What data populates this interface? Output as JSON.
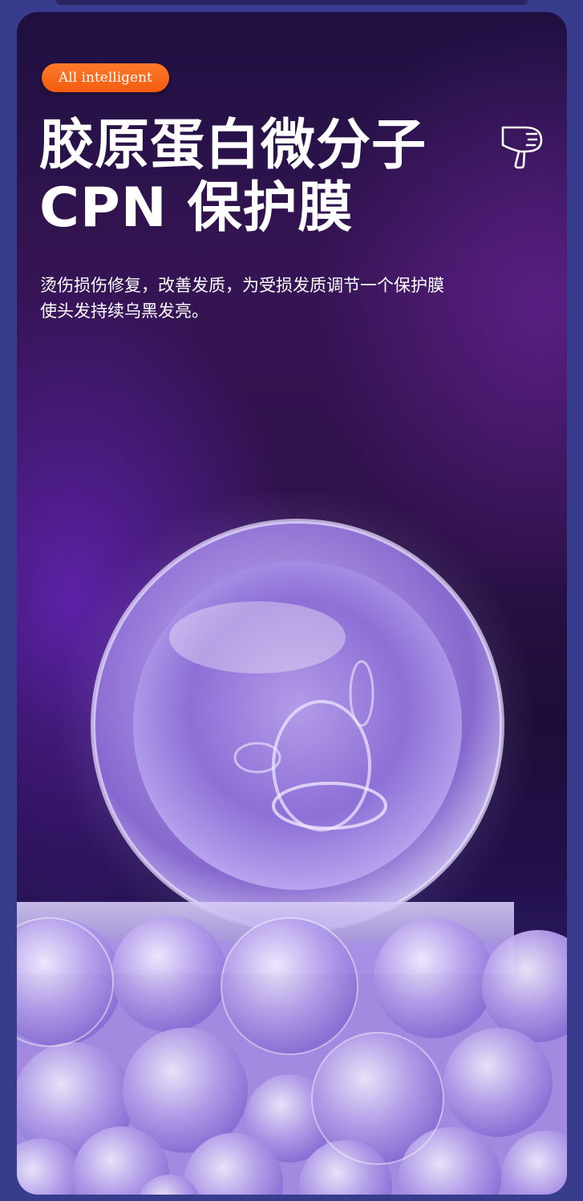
{
  "badge": {
    "label": "All intelligent"
  },
  "title": {
    "line1": "胶原蛋白微分子",
    "line2": "CPN 保护膜"
  },
  "description": {
    "line1": "烫伤损伤修复，改善发质，为受损发质调节一个保护膜",
    "line2": "使头发持续乌黑发亮。"
  },
  "icons": {
    "top_right": "hair-dryer-icon"
  },
  "colors": {
    "badge_bg": "#f46a1a",
    "text": "#ffffff",
    "frame_bg": "#373c8c",
    "sphere_tint": "#b9a6f0"
  }
}
